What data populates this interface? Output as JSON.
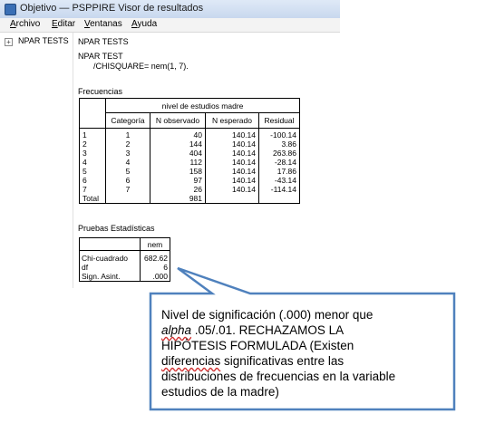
{
  "window": {
    "title": "Objetivo — PSPPIRE Visor de resultados",
    "menu": [
      "Archivo",
      "Editar",
      "Ventanas",
      "Ayuda"
    ]
  },
  "sidebar": {
    "items": [
      {
        "label": "NPAR TESTS"
      }
    ]
  },
  "output": {
    "heading": "NPAR TESTS",
    "syntax_line1": "NPAR TEST",
    "syntax_line2": "/CHISQUARE= nem(1, 7).",
    "freq_title": "Frecuencias",
    "freq_variable": "nivel de estudios madre",
    "freq_columns": [
      "Categoría",
      "N observado",
      "N esperado",
      "Residual"
    ],
    "freq_rows": [
      {
        "label": "1",
        "cat": "1",
        "obs": "40",
        "exp": "140.14",
        "res": "-100.14"
      },
      {
        "label": "2",
        "cat": "2",
        "obs": "144",
        "exp": "140.14",
        "res": "3.86"
      },
      {
        "label": "3",
        "cat": "3",
        "obs": "404",
        "exp": "140.14",
        "res": "263.86"
      },
      {
        "label": "4",
        "cat": "4",
        "obs": "112",
        "exp": "140.14",
        "res": "-28.14"
      },
      {
        "label": "5",
        "cat": "5",
        "obs": "158",
        "exp": "140.14",
        "res": "17.86"
      },
      {
        "label": "6",
        "cat": "6",
        "obs": "97",
        "exp": "140.14",
        "res": "-43.14"
      },
      {
        "label": "7",
        "cat": "7",
        "obs": "26",
        "exp": "140.14",
        "res": "-114.14"
      },
      {
        "label": "Total",
        "cat": "",
        "obs": "981",
        "exp": "",
        "res": ""
      }
    ],
    "stats_title": "Pruebas Estadísticas",
    "stats_column": "nem",
    "stats_rows": [
      {
        "label": "Chi-cuadrado",
        "value": "682.62"
      },
      {
        "label": "df",
        "value": "6"
      },
      {
        "label": "Sign. Asint.",
        "value": ".000"
      }
    ]
  },
  "callout": {
    "line1": "Nivel de significación (.000) menor que",
    "line2_italic": "alpha",
    "line2_rest": " .05/.01. RECHAZAMOS LA",
    "line3": "HIPÓTESIS FORMULADA (Existen",
    "line4_underlined": "diferencias",
    "line4_rest": " significativas entre las",
    "line5": "distribuciones de frecuencias en la variable",
    "line6": "estudios de la madre)",
    "border_color": "#4f81bd"
  }
}
